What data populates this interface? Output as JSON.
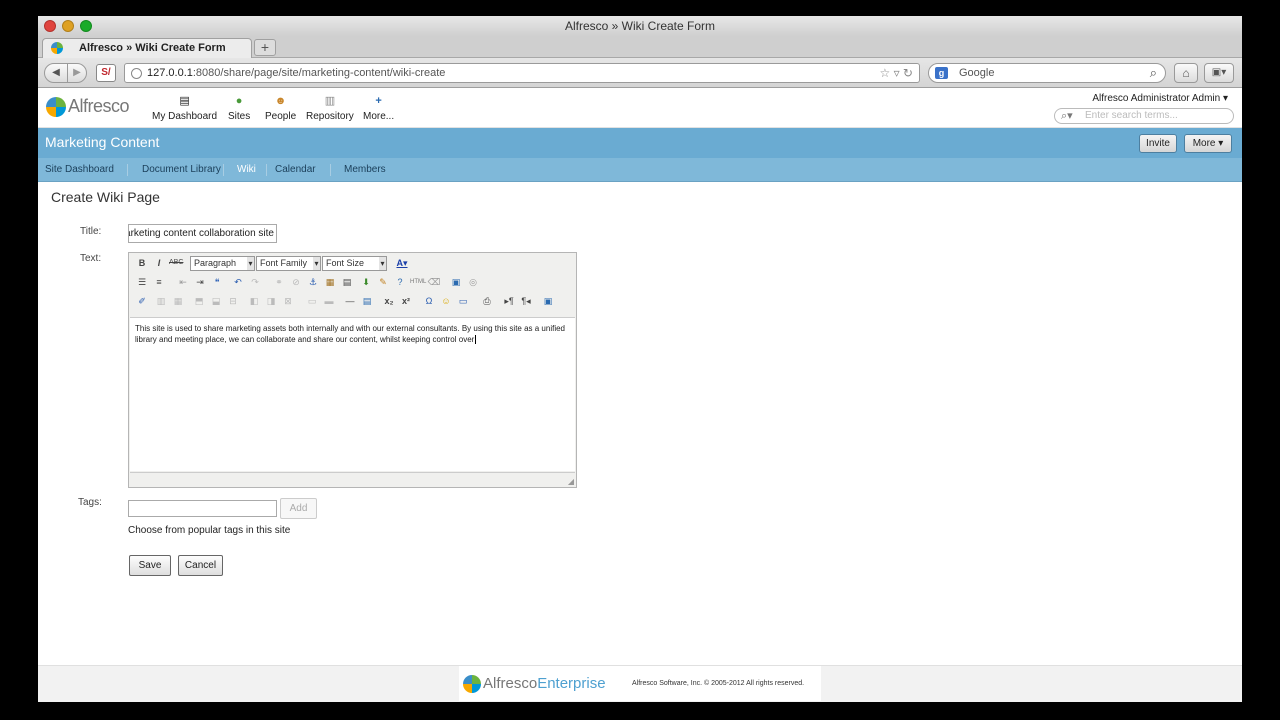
{
  "browser": {
    "window_title": "Alfresco » Wiki Create Form",
    "tab_title": "Alfresco » Wiki Create Form",
    "url_host": "127.0.0.1",
    "url_path": ":8080/share/page/site/marketing-content/wiki-create",
    "search_placeholder": "Google",
    "si_label": "S/"
  },
  "header": {
    "logo_text": "Alfresco",
    "nav": [
      {
        "label": "My Dashboard",
        "icon": "dashboard-icon"
      },
      {
        "label": "Sites",
        "icon": "sites-icon"
      },
      {
        "label": "People",
        "icon": "people-icon"
      },
      {
        "label": "Repository",
        "icon": "repository-icon"
      },
      {
        "label": "More...",
        "icon": "plus-icon"
      }
    ],
    "user_menu": "Alfresco Administrator Admin ▾",
    "search_placeholder": "Enter search terms..."
  },
  "site": {
    "title": "Marketing Content",
    "invite_label": "Invite",
    "more_label": "More ▾",
    "nav": [
      "Site Dashboard",
      "Document Library",
      "Wiki",
      "Calendar",
      "Members"
    ]
  },
  "form": {
    "page_title": "Create Wiki Page",
    "title_label": "Title:",
    "title_value": "arketing content collaboration site",
    "text_label": "Text:",
    "paragraph_select": "Paragraph",
    "font_family_select": "Font Family",
    "font_size_select": "Font Size",
    "body_text": "This site is used to share marketing assets both internally and with our external consultants. By using this site as a unified library and meeting place, we can collaborate and share our content, whilst keeping control over",
    "tags_label": "Tags:",
    "add_label": "Add",
    "popular_tags": "Choose from popular tags in this site",
    "save_label": "Save",
    "cancel_label": "Cancel"
  },
  "footer": {
    "logo_text": "Alfresco",
    "edition": "Enterprise",
    "copyright": "Alfresco Software, Inc. © 2005-2012 All rights reserved."
  },
  "colors": {
    "site_bar": "#6aabd2",
    "site_nav": "#7fb8d9"
  }
}
